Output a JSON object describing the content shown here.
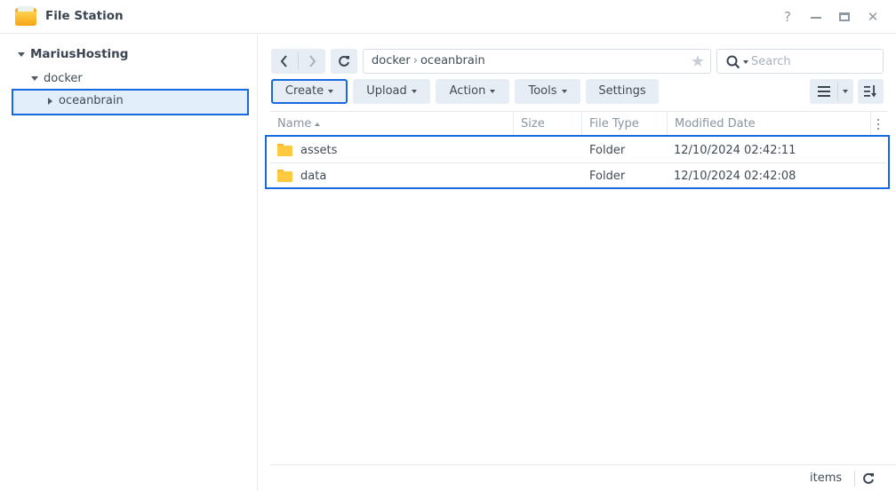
{
  "window": {
    "title": "File Station",
    "app_icon": "file-station-folder-icon",
    "controls": {
      "help": "?",
      "help_icon": "help-icon",
      "minimize_icon": "minimize-icon",
      "maximize_icon": "maximize-icon",
      "close": "✕",
      "close_icon": "close-icon"
    }
  },
  "sidebar": {
    "root": "MariusHosting",
    "items": [
      {
        "label": "docker",
        "expanded": true
      },
      {
        "label": "oceanbrain",
        "selected": true,
        "expanded": false
      }
    ]
  },
  "toolbar": {
    "back_icon": "chevron-left-icon",
    "forward_icon": "chevron-right-icon",
    "refresh_icon": "refresh-icon",
    "path": [
      "docker",
      "oceanbrain"
    ],
    "path_separator": "›",
    "favorite_icon": "star-icon",
    "favorite": "★",
    "search_placeholder": "Search",
    "search_value": "",
    "buttons": {
      "create": "Create",
      "upload": "Upload",
      "action": "Action",
      "tools": "Tools",
      "settings": "Settings"
    },
    "view_icon": "list-view-icon",
    "sort_icon": "sort-icon"
  },
  "table": {
    "columns": [
      "Name",
      "Size",
      "File Type",
      "Modified Date"
    ],
    "sort_column": "Name",
    "sort_direction": "ascending",
    "rows": [
      {
        "name": "assets",
        "size": "",
        "type": "Folder",
        "modified": "12/10/2024 02:42:11"
      },
      {
        "name": "data",
        "size": "",
        "type": "Folder",
        "modified": "12/10/2024 02:42:08"
      }
    ]
  },
  "footer": {
    "items_label": "items",
    "refresh_icon": "refresh-icon"
  },
  "colors": {
    "accent": "#1769e0",
    "selection_bg": "#e3eefb",
    "button_bg": "#e7edf4",
    "folder": "#ffc940"
  }
}
